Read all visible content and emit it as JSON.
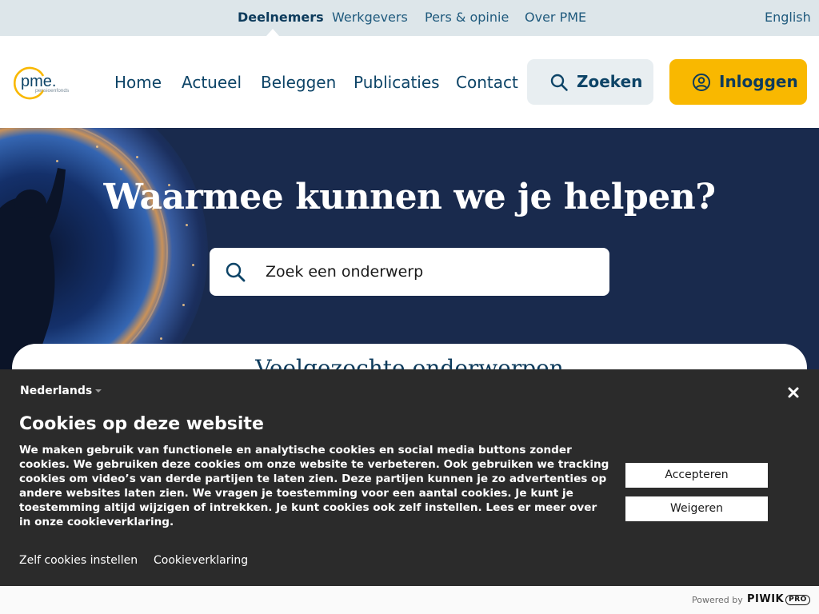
{
  "topbar": {
    "audiences": [
      "Deelnemers",
      "Werkgevers",
      "Pers & opinie",
      "Over PME"
    ],
    "active": "Deelnemers",
    "language": "English"
  },
  "header": {
    "logo_text": "pme.",
    "logo_sub": "pensioenfonds",
    "nav": [
      "Home",
      "Actueel",
      "Beleggen",
      "Publicaties",
      "Contact"
    ],
    "search_label": "Zoeken",
    "login_label": "Inloggen"
  },
  "hero": {
    "title": "Waarmee kunnen we je helpen?",
    "search_placeholder": "Zoek een onderwerp"
  },
  "topics": {
    "title": "Veelgezochte onderwerpen"
  },
  "cookie": {
    "language": "Nederlands",
    "title": "Cookies op deze website",
    "body": "We maken gebruik van functionele en analytische cookies en social media buttons zonder cookies. We gebruiken deze cookies om onze website te verbeteren. Ook gebruiken we tracking cookies om video’s van derde partijen te laten zien. Deze partijen kunnen je zo advertenties op andere websites laten zien. We vragen je toestemming voor een aantal cookies. Je kunt je toestemming altijd wijzigen of intrekken. Je kunt cookies ook zelf instellen. Lees er meer over in onze cookieverklaring.",
    "accept_label": "Accepteren",
    "reject_label": "Weigeren",
    "settings_link": "Zelf cookies instellen",
    "policy_link": "Cookieverklaring"
  },
  "powered": {
    "label": "Powered by",
    "brand": "PIWIK",
    "brand_suffix": "PRO"
  },
  "colors": {
    "primary": "#0d3b5c",
    "accent": "#f9b800",
    "topbar_bg": "#dde6ea",
    "hero_bg": "#192a4d",
    "cookie_bg": "#2b2b2b"
  },
  "icons": [
    "search-icon",
    "user-circle-icon",
    "close-icon",
    "chevron-down-icon"
  ]
}
